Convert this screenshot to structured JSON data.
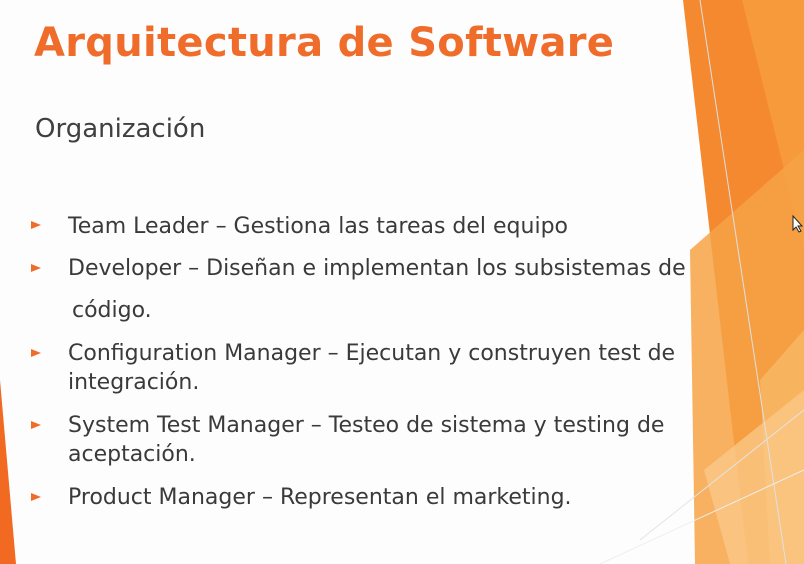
{
  "slide": {
    "title": "Arquitectura de Software",
    "subtitle": "Organización",
    "bullets": [
      {
        "text": "Team Leader – Gestiona las tareas del equipo"
      },
      {
        "text": "Developer – Diseñan e implementan los subsistemas de"
      },
      {
        "text": "código."
      },
      {
        "text": "Configuration Manager – Ejecutan y construyen test de integración."
      },
      {
        "text": "System Test Manager – Testeo de sistema y testing de aceptación."
      },
      {
        "text": "Product Manager – Representan el marketing."
      }
    ]
  },
  "theme": {
    "accent": "#ef6c2a",
    "accent_light": "#f8b06a",
    "text": "#3a3a3a",
    "background": "#fdfdfd"
  },
  "icons": {
    "bullet_marker": "orange-triangle-arrow",
    "mouse_pointer": "arrow-cursor"
  }
}
